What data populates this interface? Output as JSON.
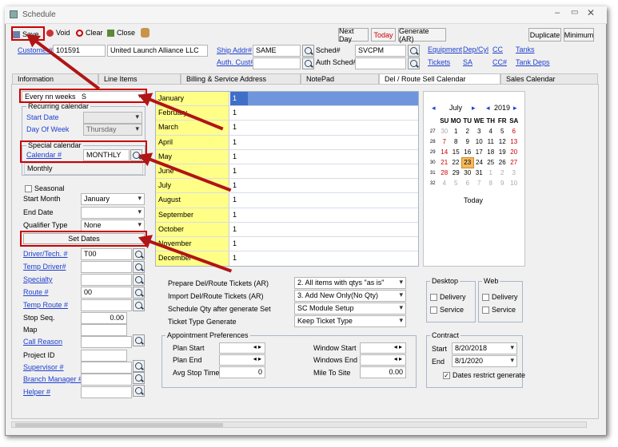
{
  "window": {
    "title": "Schedule"
  },
  "toolbar": {
    "save": "Save",
    "void": "Void",
    "clear": "Clear",
    "close": "Close",
    "next_day": "Next Day",
    "today": "Today",
    "generate": "Generate (AR)",
    "duplicate": "Duplicate",
    "minimum": "Minimum"
  },
  "header": {
    "customer_label": "Customer#",
    "customer_num": "101591",
    "customer_name": "United Launch Alliance LLC",
    "ship_addr_label": "Ship Addr#",
    "ship_addr": "SAME",
    "auth_cust_label": "Auth. Cust#",
    "sched_label": "Sched#",
    "sched": "SVCPM",
    "auth_sched_label": "Auth Sched#",
    "equipment": "Equipment",
    "dep_cyl": "Dep/Cyl",
    "cc": "CC",
    "tanks": "Tanks",
    "tickets": "Tickets",
    "sa": "SA",
    "cc_num": "CC#",
    "tank_deps": "Tank Deps"
  },
  "tabs": [
    "Information",
    "Line Items",
    "Billing & Service Address",
    "NotePad",
    "Del / Route Sell Calendar",
    "Sales Calendar"
  ],
  "left": {
    "frequency": "Every nn weeks",
    "frequency_value": "S",
    "recurring_title": "Recurring calendar",
    "start_date": "Start Date",
    "day_of_week": "Day Of Week",
    "day_of_week_value": "Thursday",
    "special_title": "Special calendar",
    "calendar_label": "Calendar #",
    "calendar_value": "MONTHLY",
    "calendar_desc": "Monthly",
    "seasonal": "Seasonal",
    "start_month": "Start Month",
    "start_month_value": "January",
    "end_date": "End Date",
    "qualifier_type": "Qualifier Type",
    "qualifier_value": "None",
    "set_dates": "Set Dates",
    "driver": "Driver/Tech. #",
    "driver_value": "T00",
    "temp_driver": "Temp Driver#",
    "specialty": "Specialty",
    "route": "Route #",
    "route_value": "00",
    "temp_route": "Temp Route #",
    "stop_seq": "Stop Seq.",
    "stop_seq_value": "0.00",
    "map": "Map",
    "call_reason": "Call Reason",
    "project_id": "Project ID",
    "supervisor": "Supervisor #",
    "branch_manager": "Branch Manager #",
    "helper": "Helper #"
  },
  "months": [
    {
      "name": "January",
      "val": "1"
    },
    {
      "name": "February",
      "val": "1"
    },
    {
      "name": "March",
      "val": "1"
    },
    {
      "name": "April",
      "val": "1"
    },
    {
      "name": "May",
      "val": "1"
    },
    {
      "name": "June",
      "val": "1"
    },
    {
      "name": "July",
      "val": "1"
    },
    {
      "name": "August",
      "val": "1"
    },
    {
      "name": "September",
      "val": "1"
    },
    {
      "name": "October",
      "val": "1"
    },
    {
      "name": "November",
      "val": "1"
    },
    {
      "name": "December",
      "val": "1"
    }
  ],
  "calendar": {
    "month": "July",
    "year": "2019",
    "today": "Today",
    "days": [
      "SU",
      "MO",
      "TU",
      "WE",
      "TH",
      "FR",
      "SA"
    ],
    "weeks": [
      {
        "wk": "27",
        "d": [
          "30",
          "1",
          "2",
          "3",
          "4",
          "5",
          "6"
        ]
      },
      {
        "wk": "28",
        "d": [
          "7",
          "8",
          "9",
          "10",
          "11",
          "12",
          "13"
        ]
      },
      {
        "wk": "29",
        "d": [
          "14",
          "15",
          "16",
          "17",
          "18",
          "19",
          "20"
        ]
      },
      {
        "wk": "30",
        "d": [
          "21",
          "22",
          "23",
          "24",
          "25",
          "26",
          "27"
        ]
      },
      {
        "wk": "31",
        "d": [
          "28",
          "29",
          "30",
          "31",
          "1",
          "2",
          "3"
        ]
      },
      {
        "wk": "32",
        "d": [
          "4",
          "5",
          "6",
          "7",
          "8",
          "9",
          "10"
        ]
      }
    ]
  },
  "options": {
    "prepare": "Prepare Del/Route Tickets (AR)",
    "prepare_value": "2. All items with qtys \"as is\"",
    "import": "Import Del/Route Tickets (AR)",
    "import_value": "3. Add New Only(No Qty)",
    "schedule_qty": "Schedule Qty after generate Set",
    "schedule_qty_value": "SC Module Setup",
    "ticket_type": "Ticket Type Generate",
    "ticket_type_value": "Keep Ticket Type"
  },
  "desktop": {
    "title": "Desktop",
    "delivery": "Delivery",
    "service": "Service"
  },
  "web": {
    "title": "Web",
    "delivery": "Delivery",
    "service": "Service"
  },
  "appt": {
    "title": "Appointment Preferences",
    "plan_start": "Plan Start",
    "plan_end": "Plan End",
    "avg_stop": "Avg Stop Time",
    "avg_stop_value": "0",
    "window_start": "Window Start",
    "windows_end": "Windows End",
    "mile_to_site": "Mile To Site",
    "mile_value": "0.00"
  },
  "contract": {
    "title": "Contract",
    "start": "Start",
    "start_value": "8/20/2018",
    "end": "End",
    "end_value": "8/1/2020",
    "restrict": "Dates restrict generate"
  }
}
